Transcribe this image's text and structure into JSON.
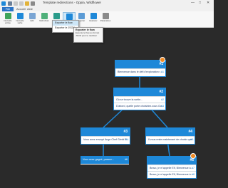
{
  "window": {
    "title": "Template redirections - Oppia, Wildflower"
  },
  "menu": {
    "file": "File",
    "items": [
      "Accueil",
      "Aide"
    ]
  },
  "ribbon": {
    "buttons": [
      "Nouvelle entrée",
      "Nouvelle sortie",
      "Edit",
      "Multi choix",
      "Test",
      "Exporter",
      "Importer",
      "Exécuter",
      "Paramètres"
    ],
    "colors": {
      "blue": "#1e88d8",
      "green": "#3fa45a",
      "orange": "#f08a24"
    }
  },
  "dropdown": {
    "items": [
      "Exporter le flow",
      "Exporter le JSON"
    ]
  },
  "tooltip": {
    "title": "Exporter le flow",
    "text": "Exporte le flow au format JSON pour le réutiliser"
  },
  "nodes": [
    {
      "id": "n1",
      "number": "#1",
      "rows": [
        {
          "text": "Bienvenue dans le défi d'exploration r...",
          "num": "#1"
        }
      ]
    },
    {
      "id": "n2",
      "number": "#2",
      "rows": [
        {
          "text": "Où se trouve la sortie...",
          "num": "#2"
        },
        {
          "text": "D'abord, quelle porte choisiriez-vous Go...",
          "num": "#3"
        }
      ]
    },
    {
      "id": "n3",
      "number": "#3",
      "rows": [
        {
          "text": "Vous avez envoyé Ange Chef Gimbl B...",
          "num": "#4"
        }
      ]
    },
    {
      "id": "n4",
      "number": "#4",
      "rows": [
        {
          "text": "Il vous reste maintenant de choisir que...",
          "num": "#5"
        }
      ]
    },
    {
      "id": "n5",
      "number": "#5",
      "rows": [
        {
          "text": "Vous avez gagné, passez...",
          "num": "#6"
        }
      ]
    },
    {
      "id": "n6",
      "number": "#6",
      "rows": [
        {
          "text": "Bravo, je m'appelle Elf, Bienvenue à...",
          "num": "#7"
        },
        {
          "text": "Bravo, je m'appelle Elf, Bienvenue à...",
          "num": "#8"
        }
      ]
    }
  ]
}
